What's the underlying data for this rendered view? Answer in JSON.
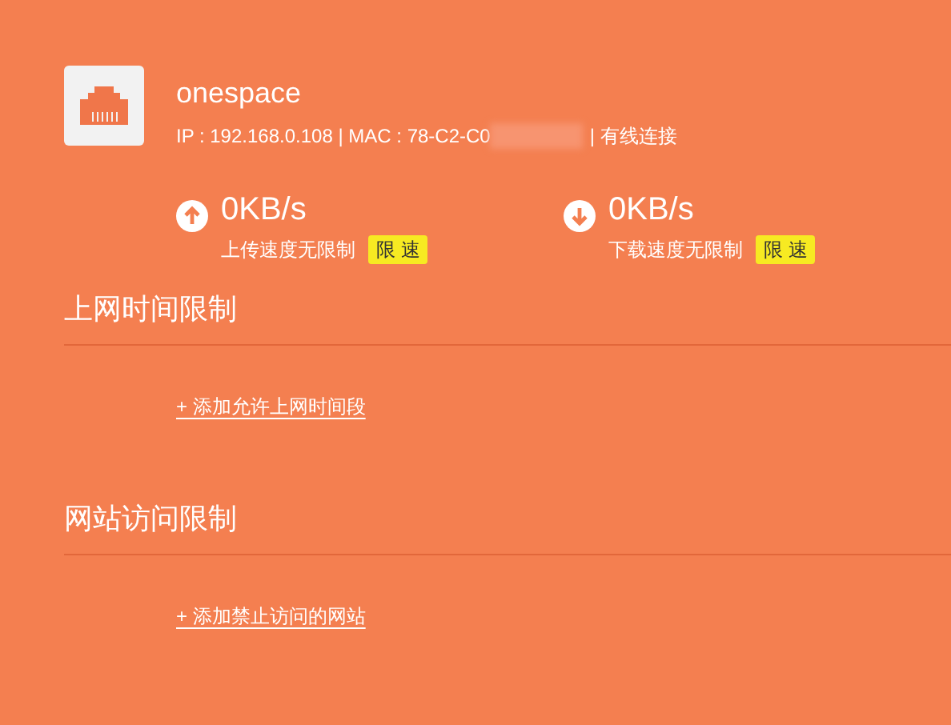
{
  "device": {
    "name": "onespace",
    "info_prefix": "IP : 192.168.0.108 | MAC : 78-C2-C0",
    "info_suffix": "| 有线连接"
  },
  "speeds": [
    {
      "kind": "upload",
      "value": "0KB/s",
      "label": "上传速度无限制",
      "button": "限 速"
    },
    {
      "kind": "download",
      "value": "0KB/s",
      "label": "下载速度无限制",
      "button": "限 速"
    }
  ],
  "sections": [
    {
      "title": "上网时间限制",
      "link": "+ 添加允许上网时间段"
    },
    {
      "title": "网站访问限制",
      "link": "+ 添加禁止访问的网站"
    }
  ]
}
